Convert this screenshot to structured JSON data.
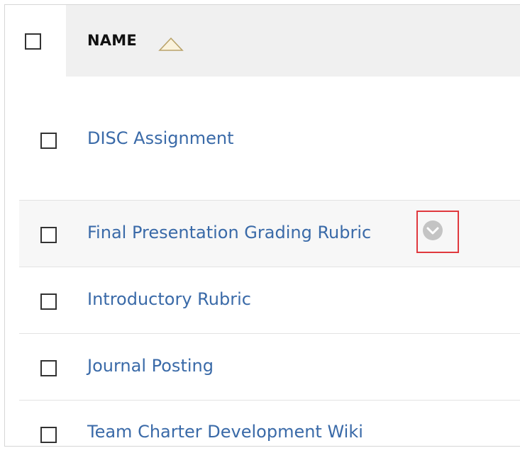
{
  "table": {
    "column_name_label": "NAME",
    "sort_icon": "sort-ascending-triangle-icon",
    "rows": [
      {
        "label": "DISC Assignment"
      },
      {
        "label": "Final Presentation Grading Rubric",
        "menu_icon": "chevron-down-circle-icon"
      },
      {
        "label": "Introductory Rubric"
      },
      {
        "label": "Journal Posting"
      },
      {
        "label": "Team Charter Development Wiki"
      }
    ]
  },
  "colors": {
    "link": "#3a6aa8",
    "header_background": "#f0f0f0",
    "highlight_border": "#e0393e"
  }
}
